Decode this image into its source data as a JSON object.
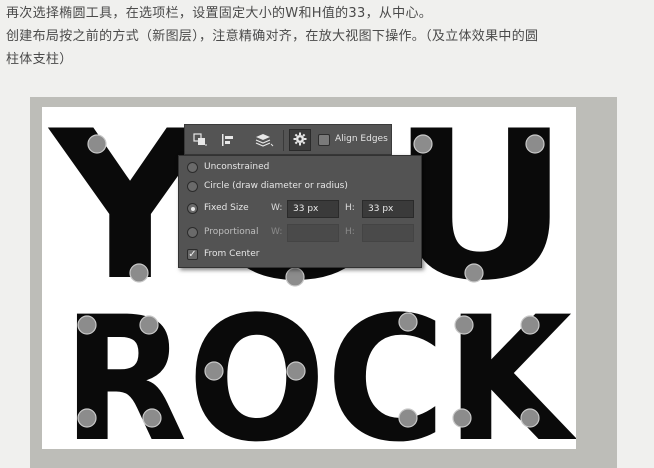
{
  "instructions": {
    "line1": "再次选择椭圆工具，在选项栏，设置固定大小的W和H值的33，从中心。",
    "line2": "创建布局按之前的方式（新图层），注意精确对齐，在放大视图下操作。（及立体效果中的圆",
    "line3": "柱体支柱）"
  },
  "canvas": {
    "word1": "YOU",
    "word2": "ROCK"
  },
  "optionsbar": {
    "icons": [
      "path-operations-icon",
      "path-alignment-icon",
      "path-arrangement-icon",
      "gear-icon"
    ],
    "align_edges_label": "Align Edges",
    "align_edges_checked": false
  },
  "dropdown": {
    "unconstrained": "Unconstrained",
    "circle": "Circle (draw diameter or radius)",
    "fixed_size": "Fixed Size",
    "proportional": "Proportional",
    "selected": "Fixed Size",
    "w_label": "W:",
    "h_label": "H:",
    "fixed_w": "33 px",
    "fixed_h": "33 px",
    "from_center": "From Center",
    "from_center_checked": true
  }
}
